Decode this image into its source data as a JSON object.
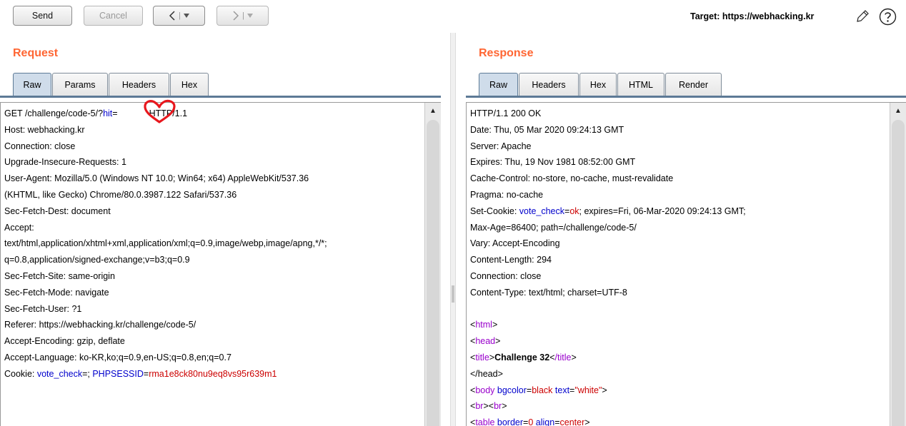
{
  "toolbar": {
    "send_label": "Send",
    "cancel_label": "Cancel",
    "target_label": "Target: https://webhacking.kr"
  },
  "icons": {
    "back": "chevron-left-icon",
    "forward": "chevron-right-icon",
    "dropdown": "dropdown-arrow-icon",
    "edit": "pencil-icon",
    "help": "question-icon"
  },
  "colors": {
    "title": "#ff6633",
    "param_name": "#0000cc",
    "param_value": "#cc0000",
    "html_tag": "#9900cc",
    "annotation": "#e8171d"
  },
  "request": {
    "title": "Request",
    "tabs": [
      "Raw",
      "Params",
      "Headers",
      "Hex"
    ],
    "active_tab": "Raw",
    "line1": {
      "pre": "GET /challenge/code-5/?",
      "param": "hit",
      "eq": "=",
      "post": "HTTP/1.1"
    },
    "lines": [
      "Host: webhacking.kr",
      "Connection: close",
      "Upgrade-Insecure-Requests: 1",
      "User-Agent: Mozilla/5.0 (Windows NT 10.0; Win64; x64) AppleWebKit/537.36",
      "(KHTML, like Gecko) Chrome/80.0.3987.122 Safari/537.36",
      "Sec-Fetch-Dest: document",
      "Accept:",
      "text/html,application/xhtml+xml,application/xml;q=0.9,image/webp,image/apng,*/*;",
      "q=0.8,application/signed-exchange;v=b3;q=0.9",
      "Sec-Fetch-Site: same-origin",
      "Sec-Fetch-Mode: navigate",
      "Sec-Fetch-User: ?1",
      "Referer: https://webhacking.kr/challenge/code-5/",
      "Accept-Encoding: gzip, deflate",
      "Accept-Language: ko-KR,ko;q=0.9,en-US;q=0.8,en;q=0.7"
    ],
    "cookie": {
      "pre": "Cookie: ",
      "name1": "vote_check",
      "mid": "=; ",
      "name2": "PHPSESSID",
      "eq": "=",
      "value2": "rma1e8ck80nu9eq8vs95r639m1"
    }
  },
  "response": {
    "title": "Response",
    "tabs": [
      "Raw",
      "Headers",
      "Hex",
      "HTML",
      "Render"
    ],
    "active_tab": "Raw",
    "lines_a": [
      "HTTP/1.1 200 OK",
      "Date: Thu, 05 Mar 2020 09:24:13 GMT",
      "Server: Apache",
      "Expires: Thu, 19 Nov 1981 08:52:00 GMT",
      "Cache-Control: no-store, no-cache, must-revalidate",
      "Pragma: no-cache"
    ],
    "set_cookie": {
      "pre": "Set-Cookie: ",
      "name": "vote_check",
      "eq": "=",
      "value": "ok",
      "post": "; expires=Fri, 06-Mar-2020 09:24:13 GMT;"
    },
    "lines_b": [
      "Max-Age=86400; path=/challenge/code-5/",
      "Vary: Accept-Encoding",
      "Content-Length: 294",
      "Connection: close",
      "Content-Type: text/html; charset=UTF-8"
    ],
    "html": {
      "lt": "<",
      "gt": ">",
      "html_tag": "html",
      "head_tag": "head",
      "title_tag": "title",
      "title_text": "Challenge 32",
      "title_close": "/title",
      "head_close_line": "</head>",
      "body_tag": "body",
      "bgcolor_attr": "bgcolor",
      "bgcolor_val": "black",
      "text_attr": "text",
      "text_val": "\"white\"",
      "br_tag": "br",
      "table_tag": "table",
      "border_attr": "border",
      "border_val": "0",
      "align_attr": "align",
      "align_val": "center"
    }
  }
}
